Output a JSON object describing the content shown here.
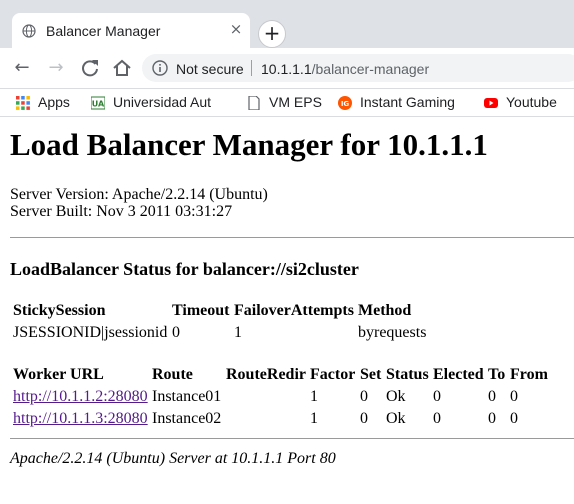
{
  "browser": {
    "tab_title": "Balancer Manager",
    "new_tab_label": "+",
    "close_glyph": "×",
    "security_label": "Not secure",
    "url_host": "10.1.1.1",
    "url_path": "/balancer-manager",
    "bookmarks": [
      {
        "label": "Apps",
        "icon": "apps-grid-icon"
      },
      {
        "label": "Universidad Aut",
        "icon": "university-icon"
      },
      {
        "label": "VM EPS",
        "icon": "document-icon"
      },
      {
        "label": "Instant Gaming",
        "icon": "instant-gaming-icon"
      },
      {
        "label": "Youtube",
        "icon": "youtube-icon"
      }
    ],
    "colors": {
      "youtube": "#ff0000",
      "instant_gaming": "#ff5400",
      "link_visited": "#551a8b"
    }
  },
  "page": {
    "title": "Load Balancer Manager for 10.1.1.1",
    "server_version": "Server Version: Apache/2.2.14 (Ubuntu)",
    "server_built": "Server Built: Nov 3 2011 03:31:27",
    "balancer_heading": "LoadBalancer Status for balancer://si2cluster",
    "status_headers": [
      "StickySession",
      "Timeout",
      "FailoverAttempts",
      "Method"
    ],
    "status_values": [
      "JSESSIONID|jsessionid",
      "0",
      "1",
      "byrequests"
    ],
    "worker_headers": [
      "Worker URL",
      "Route",
      "RouteRedir",
      "Factor",
      "Set",
      "Status",
      "Elected",
      "To",
      "From"
    ],
    "workers": [
      {
        "url": "http://10.1.1.2:28080",
        "route": "Instance01",
        "redir": "",
        "factor": "1",
        "set": "0",
        "status": "Ok",
        "elected": "0",
        "to": "0",
        "from": "0"
      },
      {
        "url": "http://10.1.1.3:28080",
        "route": "Instance02",
        "redir": "",
        "factor": "1",
        "set": "0",
        "status": "Ok",
        "elected": "0",
        "to": "0",
        "from": "0"
      }
    ],
    "footer": "Apache/2.2.14 (Ubuntu) Server at 10.1.1.1 Port 80"
  }
}
